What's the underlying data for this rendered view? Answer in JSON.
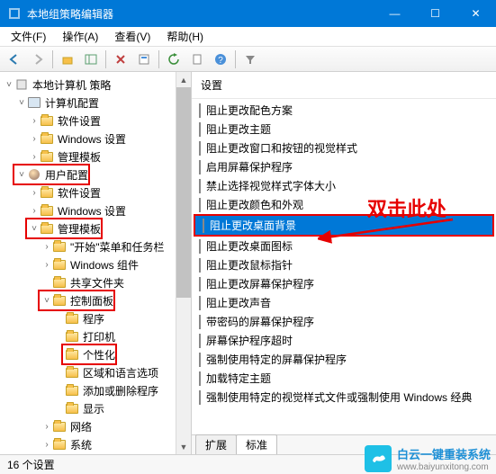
{
  "window": {
    "title": "本地组策略编辑器",
    "min": "—",
    "max": "☐",
    "close": "✕"
  },
  "menu": {
    "file": "文件(F)",
    "action": "操作(A)",
    "view": "查看(V)",
    "help": "帮助(H)"
  },
  "tree": {
    "root": "本地计算机 策略",
    "computer_config": "计算机配置",
    "cc_software": "软件设置",
    "cc_windows": "Windows 设置",
    "cc_templates": "管理模板",
    "user_config": "用户配置",
    "uc_software": "软件设置",
    "uc_windows": "Windows 设置",
    "uc_templates": "管理模板",
    "start_taskbar": "\"开始\"菜单和任务栏",
    "windows_components": "Windows 组件",
    "shared_folders": "共享文件夹",
    "control_panel": "控制面板",
    "programs": "程序",
    "printers": "打印机",
    "personalization": "个性化",
    "region_lang": "区域和语言选项",
    "add_remove": "添加或删除程序",
    "display": "显示",
    "network": "网络",
    "system": "系统"
  },
  "content": {
    "header": "设置",
    "items": [
      "阻止更改配色方案",
      "阻止更改主题",
      "阻止更改窗口和按钮的视觉样式",
      "启用屏幕保护程序",
      "禁止选择视觉样式字体大小",
      "阻止更改颜色和外观",
      "阻止更改桌面背景",
      "阻止更改桌面图标",
      "阻止更改鼠标指针",
      "阻止更改屏幕保护程序",
      "阻止更改声音",
      "带密码的屏幕保护程序",
      "屏幕保护程序超时",
      "强制使用特定的屏幕保护程序",
      "加载特定主题",
      "强制使用特定的视觉样式文件或强制使用 Windows 经典"
    ],
    "selected_index": 6
  },
  "annotation": {
    "text": "双击此处"
  },
  "tabs": {
    "extended": "扩展",
    "standard": "标准"
  },
  "status": {
    "text": "16 个设置"
  },
  "watermark": {
    "line1": "白云一键重装系统",
    "line2": "www.baiyunxitong.com"
  }
}
